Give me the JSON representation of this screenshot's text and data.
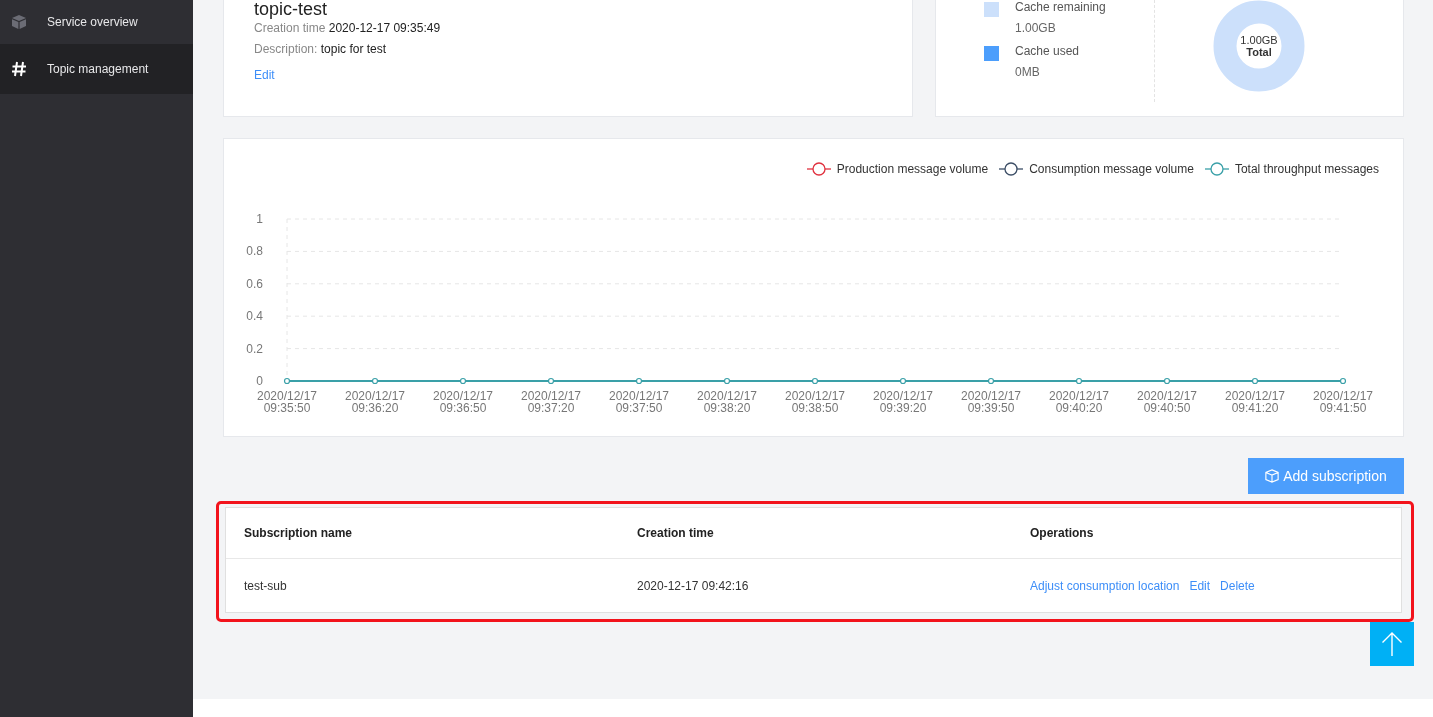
{
  "sidebar": {
    "items": [
      {
        "label": "Service overview",
        "selected": false
      },
      {
        "label": "Topic management",
        "selected": true
      }
    ]
  },
  "topic": {
    "title": "topic-test",
    "fields": [
      {
        "label": "Creation time",
        "value": "2020-12-17 09:35:49"
      },
      {
        "label": "Description:",
        "value": "topic for test"
      }
    ],
    "edit_link": "Edit"
  },
  "cache": {
    "legend": [
      {
        "label": "Cache remaining",
        "value": "1.00GB",
        "color": "#cce0fb"
      },
      {
        "label": "Cache used",
        "value": "0MB",
        "color": "#4c9efc"
      }
    ],
    "donut": {
      "value": "1.00GB",
      "label": "Total"
    }
  },
  "chart": {
    "chart_data": {
      "type": "line",
      "categories": [
        "2020/12/17 09:35:50",
        "2020/12/17 09:36:20",
        "2020/12/17 09:36:50",
        "2020/12/17 09:37:20",
        "2020/12/17 09:37:50",
        "2020/12/17 09:38:20",
        "2020/12/17 09:38:50",
        "2020/12/17 09:39:20",
        "2020/12/17 09:39:50",
        "2020/12/17 09:40:20",
        "2020/12/17 09:40:50",
        "2020/12/17 09:41:20",
        "2020/12/17 09:41:50"
      ],
      "series": [
        {
          "name": "Production message volume",
          "color": "#e0303e",
          "values": [
            null,
            null,
            null,
            null,
            null,
            null,
            null,
            null,
            null,
            null,
            null,
            null,
            null
          ]
        },
        {
          "name": "Consumption message volume",
          "color": "#3c4e66",
          "values": [
            null,
            null,
            null,
            null,
            null,
            null,
            null,
            null,
            null,
            null,
            null,
            null,
            null
          ]
        },
        {
          "name": "Total throughput messages",
          "color": "#3aa0a8",
          "marker": "circle",
          "values": [
            0,
            0,
            0,
            0,
            0,
            0,
            0,
            0,
            0,
            0,
            0,
            0,
            0
          ]
        }
      ],
      "ylim": [
        0,
        1
      ],
      "yticks": [
        0,
        0.2,
        0.4,
        0.6,
        0.8,
        1
      ],
      "grid": true,
      "legend": "top-right"
    }
  },
  "add_button": "Add subscription",
  "table": {
    "highlighted": true,
    "columns": [
      "Subscription name",
      "Creation time",
      "Operations"
    ],
    "rows": [
      {
        "name": "test-sub",
        "created": "2020-12-17 09:42:16",
        "actions": [
          "Adjust consumption location",
          "Edit",
          "Delete"
        ]
      }
    ]
  }
}
